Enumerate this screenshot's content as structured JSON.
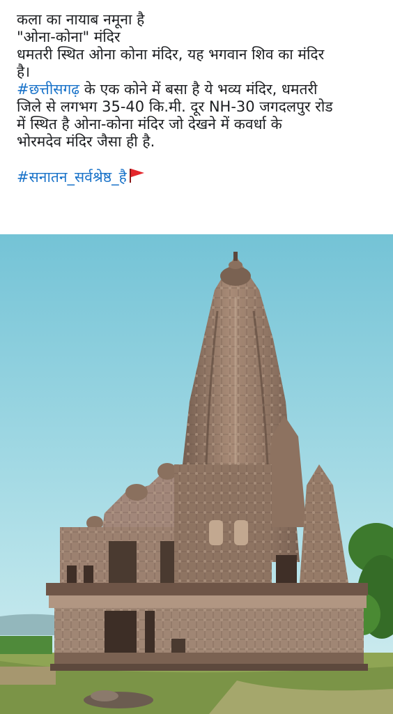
{
  "post": {
    "line1": "कला का नायाब नमूना है",
    "line2": "\"ओना-कोना\" मंदिर",
    "line3": "धमतरी स्थित ओना कोना मंदिर, यह भगवान शिव का मंदिर",
    "line4": "है।",
    "hashtag1": "#छत्तीसगढ़",
    "line5_rest": " के एक कोने में बसा है ये भव्य मंदिर, धमतरी",
    "line6": "जिले से लगभग 35-40 कि.मी. दूर NH-30 जगदलपुर रोड",
    "line7": "में स्थित है ओना-कोना मंदिर जो देखने में कवर्धा के",
    "line8": "भोरमदेव मंदिर जैसा ही है.",
    "hashtag2": "#सनातन_सर्वश्रेष्ठ_है",
    "flag_icon": "red-flag-icon"
  },
  "photo": {
    "subject": "temple-photo",
    "colors": {
      "sky_top": "#7ec9d8",
      "sky_bottom": "#c9ecef",
      "stone": "#9a7e6c",
      "stone_dark": "#6b5448",
      "grass": "#7f9a48",
      "trees": "#3f7a2c"
    }
  }
}
